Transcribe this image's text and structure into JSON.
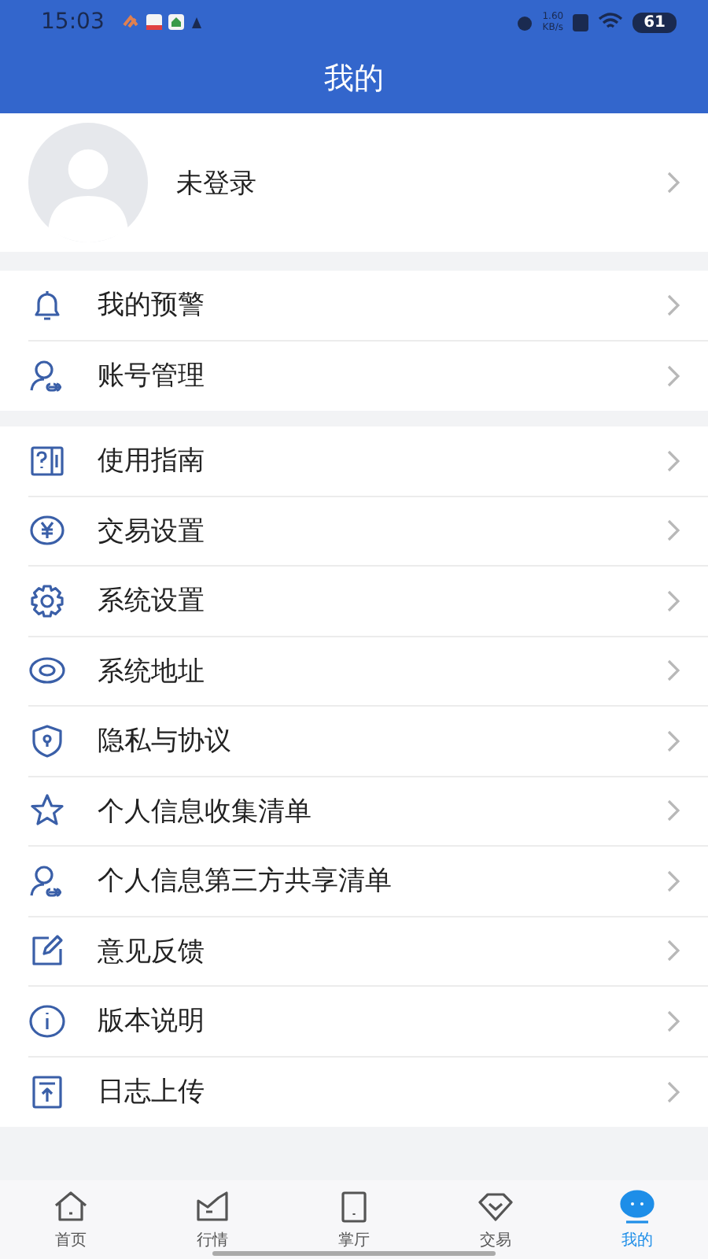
{
  "status_bar": {
    "time": "15:03",
    "speed": "1.60",
    "speed_unit": "KB/s",
    "battery": "61"
  },
  "header": {
    "title": "我的"
  },
  "profile": {
    "name": "未登录"
  },
  "groups": [
    {
      "items": [
        {
          "kind": "bell",
          "label": "我的预警"
        },
        {
          "kind": "account",
          "label": "账号管理"
        }
      ]
    },
    {
      "items": [
        {
          "kind": "guide",
          "label": "使用指南"
        },
        {
          "kind": "yen",
          "label": "交易设置"
        },
        {
          "kind": "gear",
          "label": "系统设置"
        },
        {
          "kind": "eye",
          "label": "系统地址"
        },
        {
          "kind": "shield",
          "label": "隐私与协议"
        },
        {
          "kind": "star",
          "label": "个人信息收集清单"
        },
        {
          "kind": "account",
          "label": "个人信息第三方共享清单"
        },
        {
          "kind": "edit",
          "label": "意见反馈"
        },
        {
          "kind": "info",
          "label": "版本说明"
        },
        {
          "kind": "upload",
          "label": "日志上传"
        }
      ]
    }
  ],
  "tabs": [
    {
      "kind": "home",
      "label": "首页",
      "selected": false
    },
    {
      "kind": "chart",
      "label": "行情",
      "selected": false
    },
    {
      "kind": "tablet",
      "label": "掌厅",
      "selected": false
    },
    {
      "kind": "diamond",
      "label": "交易",
      "selected": false
    },
    {
      "kind": "chat",
      "label": "我的",
      "selected": true
    }
  ]
}
